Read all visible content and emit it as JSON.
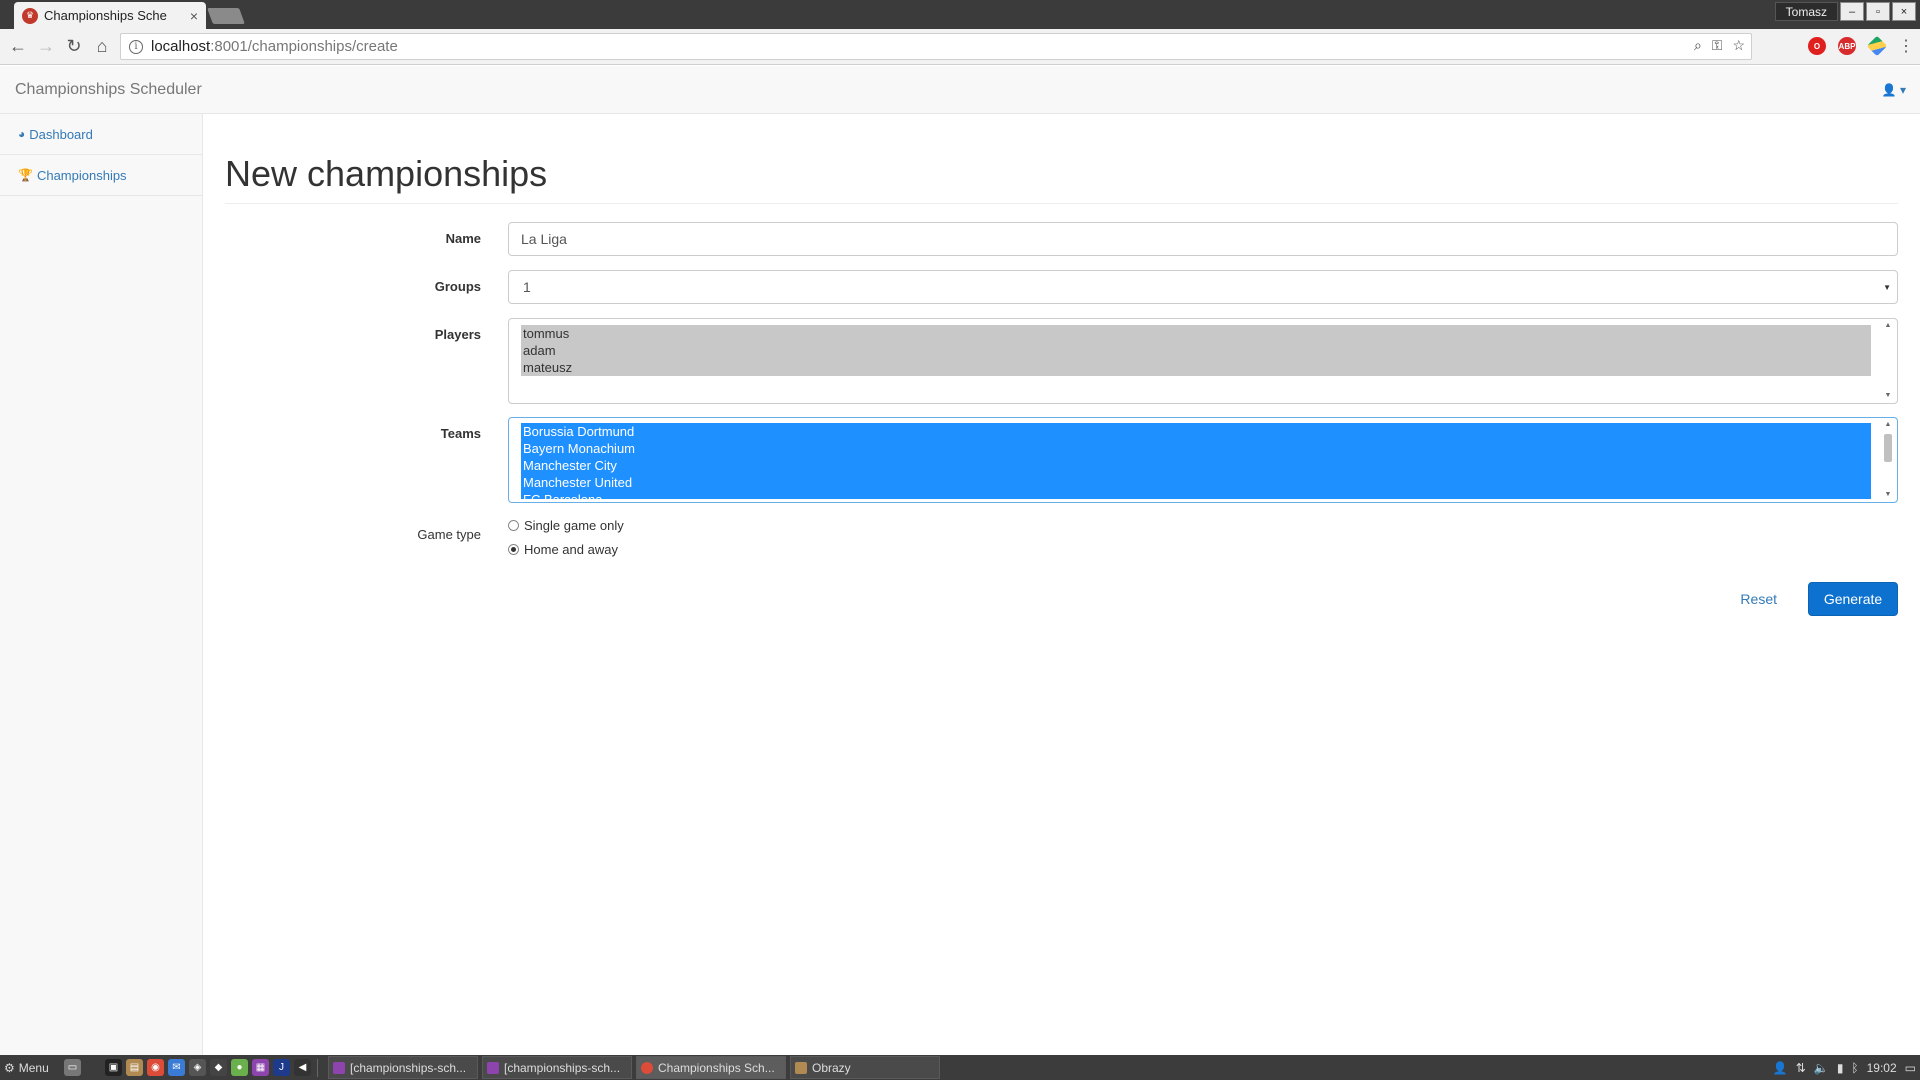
{
  "browser": {
    "tab_title": "Championships Sche",
    "tab_close": "×",
    "user_name": "Tomasz",
    "window_buttons": [
      "–",
      "▫",
      "×"
    ],
    "url_host": "localhost",
    "url_path": ":8001/championships/create"
  },
  "app": {
    "brand": "Championships Scheduler",
    "user_menu_caret": "▾"
  },
  "sidebar": {
    "items": [
      {
        "label": "Dashboard",
        "icon": "dashboard-icon"
      },
      {
        "label": "Championships",
        "icon": "trophy-icon"
      }
    ]
  },
  "page": {
    "title": "New championships"
  },
  "form": {
    "name": {
      "label": "Name",
      "value": "La Liga"
    },
    "groups": {
      "label": "Groups",
      "value": "1"
    },
    "players": {
      "label": "Players",
      "options": [
        "tommus",
        "adam",
        "mateusz"
      ]
    },
    "teams": {
      "label": "Teams",
      "options": [
        "Borussia Dortmund",
        "Bayern Monachium",
        "Manchester City",
        "Manchester United",
        "FC Barcelona"
      ]
    },
    "game_type": {
      "label": "Game type",
      "options": [
        {
          "label": "Single game only",
          "checked": false
        },
        {
          "label": "Home and away",
          "checked": true
        }
      ]
    },
    "reset_label": "Reset",
    "generate_label": "Generate"
  },
  "taskbar": {
    "menu_label": "Menu",
    "tasks": [
      "[championships-sch...",
      "[championships-sch...",
      "Championships Sch...",
      "Obrazy"
    ],
    "clock": "19:02"
  },
  "colors": {
    "primary_button": "#0d72cf",
    "link": "#337ab7",
    "selected_option": "#1e90ff"
  }
}
